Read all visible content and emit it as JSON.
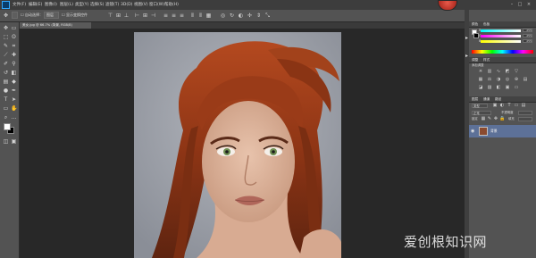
{
  "app": {
    "logo": "Ps"
  },
  "menubar": {
    "items": [
      "文件(F)",
      "编辑(E)",
      "图像(I)",
      "图层(L)",
      "类型(Y)",
      "选择(S)",
      "滤镜(T)",
      "3D(D)",
      "视图(V)",
      "窗口(W)",
      "帮助(H)"
    ]
  },
  "options_bar": {
    "auto_select_label": "自动选择：",
    "layer_dropdown": "图层",
    "transform_controls_label": "显示变换控件"
  },
  "document": {
    "tab_label": "美女.jpg @ 66.7% (背景, RGB/8)"
  },
  "panels": {
    "color": {
      "tabs": [
        "颜色",
        "色板"
      ],
      "r": "255",
      "g": "255",
      "b": "255"
    },
    "adjustments": {
      "tabs": [
        "调整",
        "样式"
      ],
      "title": "添加调整"
    },
    "layers": {
      "tabs": [
        "图层",
        "通道",
        "路径"
      ],
      "kind_label": "类型",
      "blend_mode": "正常",
      "opacity_label": "不透明度",
      "lock_label": "锁定",
      "fill_label": "填充",
      "layer_name": "背景"
    }
  },
  "watermark": {
    "text": "爱创根知识网"
  },
  "colors": {
    "accent": "#31a8ff",
    "selection": "#5d7198",
    "fg_swatch": "#ffffff",
    "bg_swatch": "#000000"
  }
}
